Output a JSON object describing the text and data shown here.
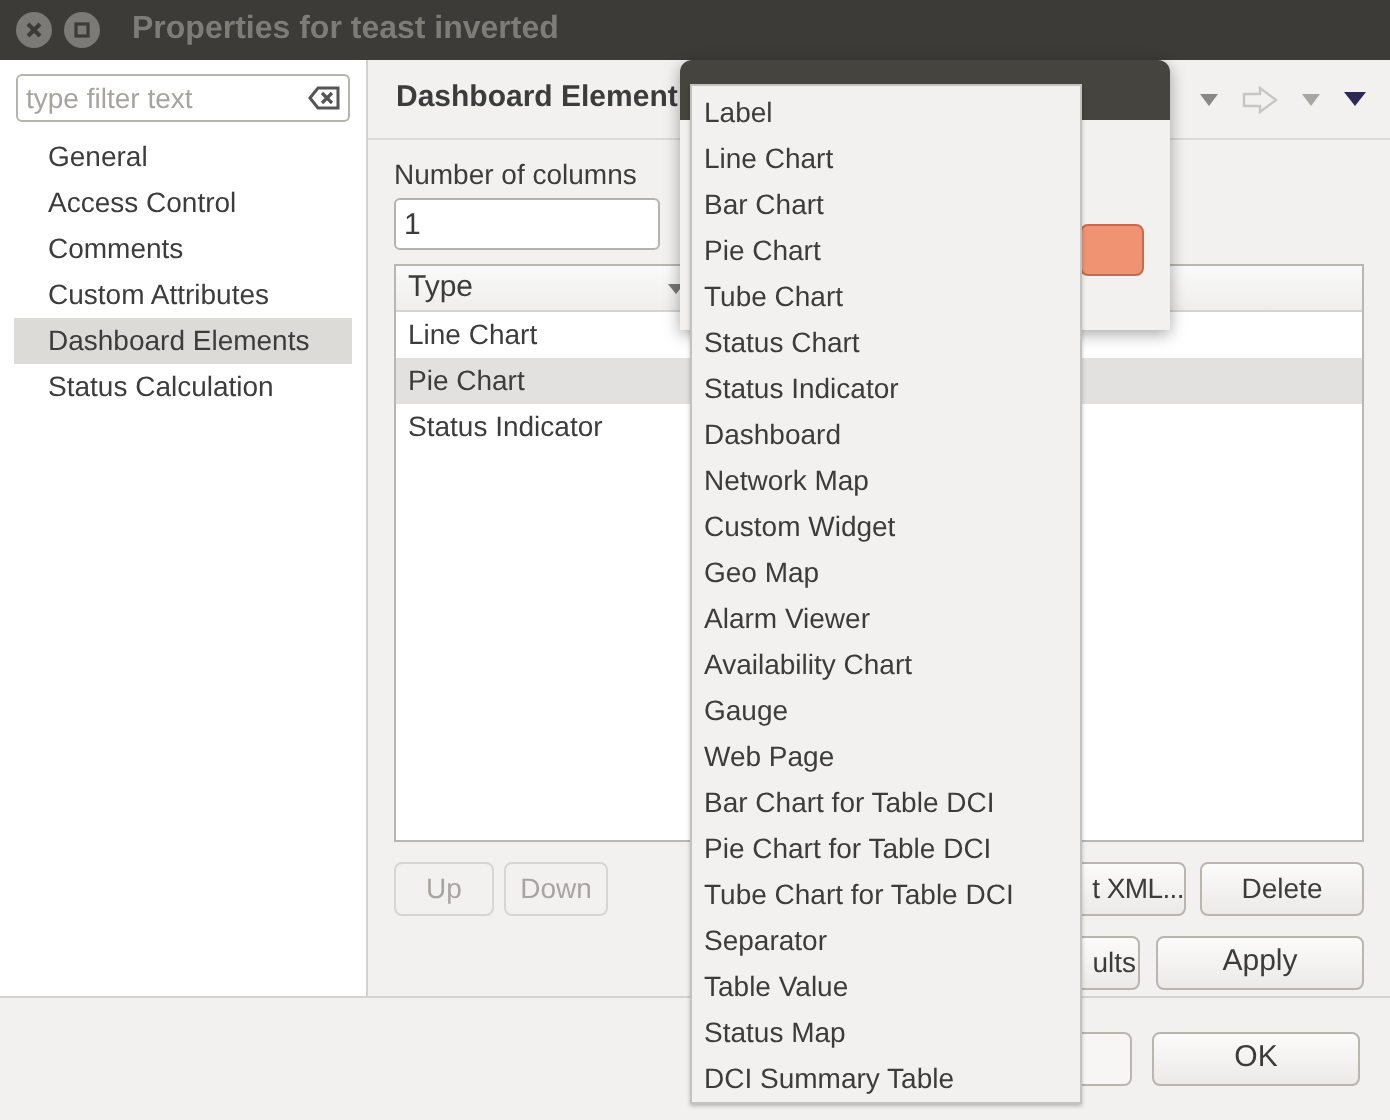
{
  "window": {
    "title": "Properties for teast inverted"
  },
  "sidebar": {
    "filter_placeholder": "type filter text",
    "items": [
      {
        "label": "General",
        "selected": false
      },
      {
        "label": "Access Control",
        "selected": false
      },
      {
        "label": "Comments",
        "selected": false
      },
      {
        "label": "Custom Attributes",
        "selected": false
      },
      {
        "label": "Dashboard Elements",
        "selected": true
      },
      {
        "label": "Status Calculation",
        "selected": false
      }
    ]
  },
  "page": {
    "title": "Dashboard Element",
    "columns_label": "Number of columns",
    "columns_value": "1",
    "table": {
      "columns": [
        "Type"
      ],
      "rows": [
        {
          "cells": [
            "Line Chart"
          ],
          "selected": false
        },
        {
          "cells": [
            "Pie Chart"
          ],
          "selected": true
        },
        {
          "cells": [
            "Status Indicator"
          ],
          "selected": false
        }
      ]
    },
    "buttons": [
      {
        "label": "Up",
        "disabled": true
      },
      {
        "label": "Down",
        "disabled": true
      },
      {
        "label": "t XML...",
        "disabled": false
      },
      {
        "label": "Delete",
        "disabled": false
      }
    ],
    "page_buttons": [
      {
        "label": "ults"
      },
      {
        "label": "Apply"
      }
    ]
  },
  "dialog_buttons": [
    {
      "label": "OK"
    }
  ],
  "popup_menu": {
    "items": [
      "Label",
      "Line Chart",
      "Bar Chart",
      "Pie Chart",
      "Tube Chart",
      "Status Chart",
      "Status Indicator",
      "Dashboard",
      "Network Map",
      "Custom Widget",
      "Geo Map",
      "Alarm Viewer",
      "Availability Chart",
      "Gauge",
      "Web Page",
      "Bar Chart for Table DCI",
      "Pie Chart for Table DCI",
      "Tube Chart for Table DCI",
      "Separator",
      "Table Value",
      "Status Map",
      "DCI Summary Table"
    ]
  }
}
